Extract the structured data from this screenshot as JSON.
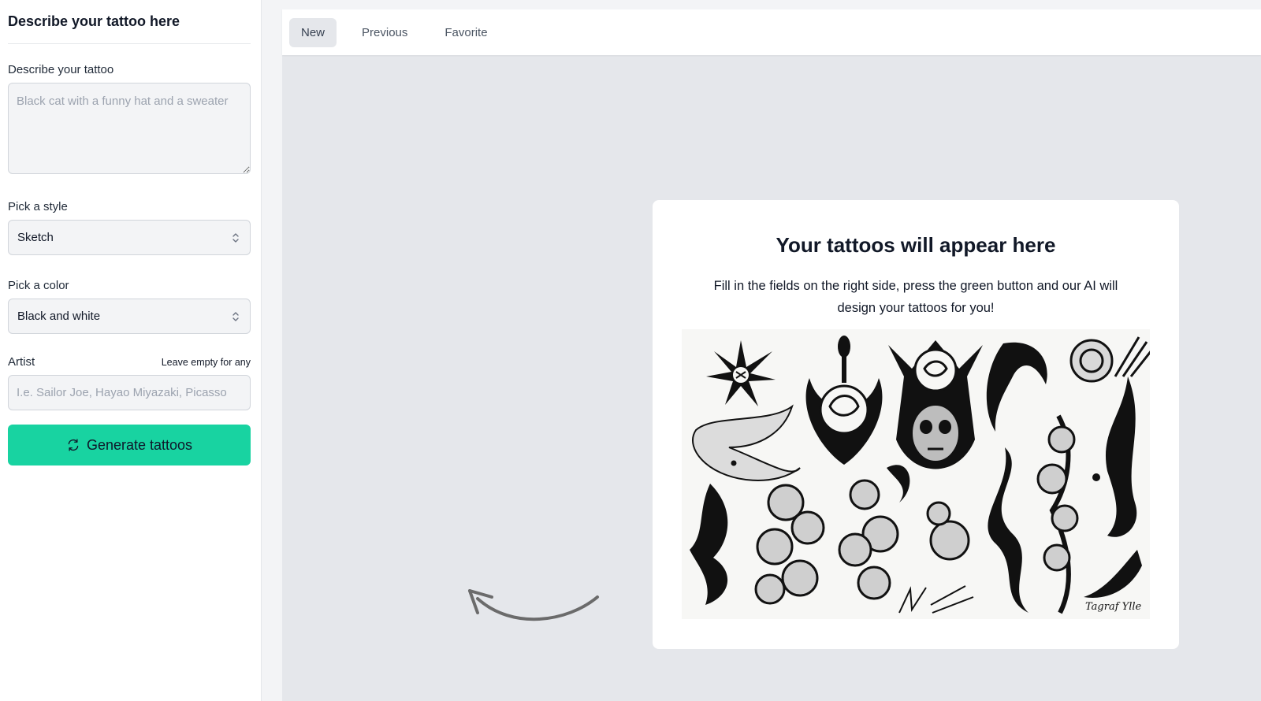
{
  "sidebar": {
    "title": "Describe your tattoo here",
    "description": {
      "label": "Describe your tattoo",
      "placeholder": "Black cat with a funny hat and a sweater",
      "value": ""
    },
    "style": {
      "label": "Pick a style",
      "selected": "Sketch"
    },
    "color": {
      "label": "Pick a color",
      "selected": "Black and white"
    },
    "artist": {
      "label": "Artist",
      "hint": "Leave empty for any",
      "placeholder": "I.e. Sailor Joe, Hayao Miyazaki, Picasso",
      "value": ""
    },
    "generate_label": "Generate tattoos",
    "button_color": "#18d3a1"
  },
  "tabs": [
    {
      "label": "New",
      "active": true
    },
    {
      "label": "Previous",
      "active": false
    },
    {
      "label": "Favorite",
      "active": false
    }
  ],
  "placeholder_card": {
    "title": "Your tattoos will appear here",
    "text": "Fill in the fields on the right side, press the green button and our AI will design your tattoos for you!",
    "image": "tattoo-flash-sheet",
    "signature_text": "Tagraf Ylle"
  },
  "icons": {
    "select_chevron": "chevron-up-down-icon",
    "generate": "refresh-icon",
    "pointer": "curved-arrow-icon"
  }
}
